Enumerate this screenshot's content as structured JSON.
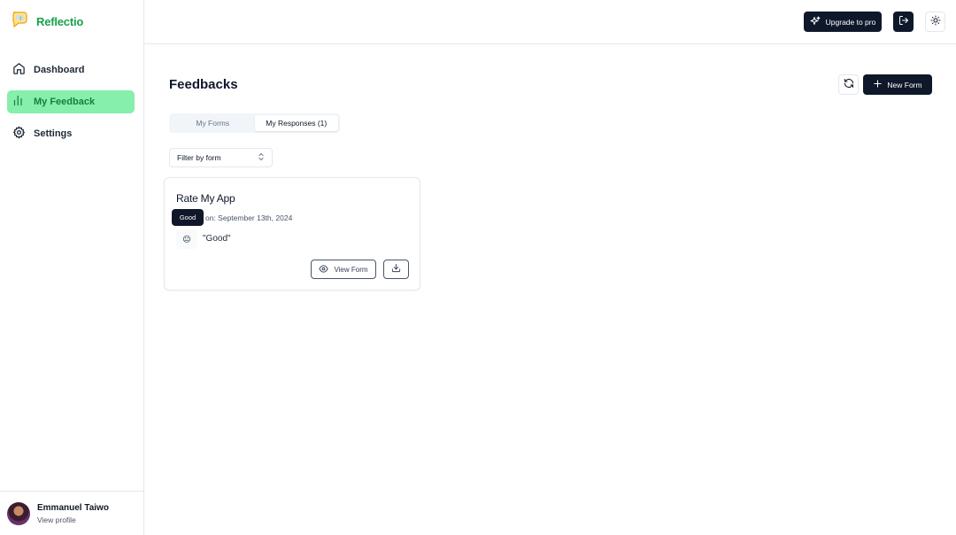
{
  "brand": {
    "name": "Reflectio",
    "color": "#16a34a",
    "logo_icon": "speech-bubble-logo"
  },
  "sidebar": {
    "items": [
      {
        "label": "Dashboard",
        "icon": "home-icon",
        "active": false
      },
      {
        "label": "My Feedback",
        "icon": "bar-chart-icon",
        "active": true
      },
      {
        "label": "Settings",
        "icon": "gear-icon",
        "active": false
      }
    ],
    "active_color": "#86efac"
  },
  "profile": {
    "name": "Emmanuel Taiwo",
    "link": "View profile"
  },
  "topbar": {
    "upgrade_label": "Upgrade to pro",
    "upgrade_icon": "sparkles-icon",
    "logout_icon": "logout-icon",
    "theme_icon": "sun-icon"
  },
  "main": {
    "title": "Feedbacks",
    "refresh_icon": "refresh-icon",
    "new_form_label": "New Form",
    "tabs": [
      {
        "label": "My Forms",
        "active": false
      },
      {
        "label": "My Responses (1)",
        "active": true
      }
    ],
    "filter": {
      "value": "Filter by form",
      "icon": "chevron-up-down-icon"
    }
  },
  "card": {
    "title": "Rate My App",
    "date": "on: September 13th, 2024",
    "tooltip": "Good",
    "emoji": "😐",
    "response": "\"Good\"",
    "view_form_label": "View Form",
    "view_icon": "eye-icon",
    "download_icon": "download-icon"
  }
}
